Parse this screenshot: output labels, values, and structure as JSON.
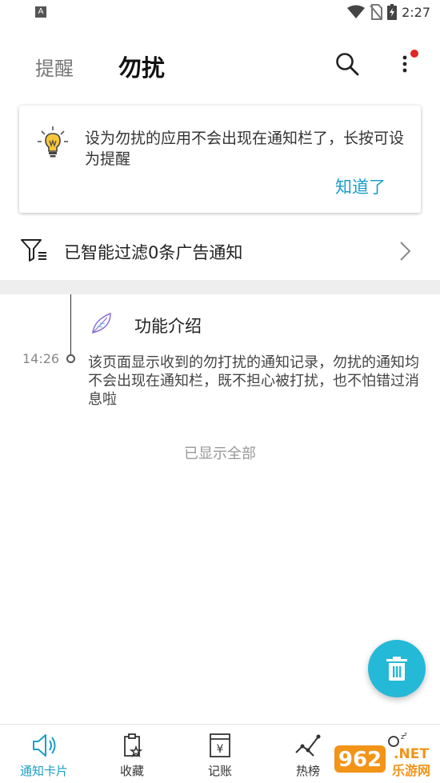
{
  "status_bar": {
    "app_icon_letter": "A",
    "time": "2:27",
    "icons": [
      "wifi-icon",
      "no-sim-icon",
      "battery-charging-icon"
    ]
  },
  "header": {
    "tab_remind": "提醒",
    "tab_dnd": "勿扰",
    "search_icon": "search-icon",
    "more_icon": "more-vertical-icon",
    "badge_color": "#e0261f"
  },
  "tip": {
    "text": "设为勿扰的应用不会出现在通知栏了，长按可设为提醒",
    "ok_label": "知道了",
    "icon": "lightbulb-icon",
    "accent": "#1a9fc7"
  },
  "filter": {
    "text": "已智能过滤0条广告通知",
    "icon": "filter-list-icon"
  },
  "timeline": {
    "entries": [
      {
        "time": "14:26",
        "title": "功能介绍",
        "body": "该页面显示收到的勿打扰的通知记录，勿扰的通知均不会出现在通知栏，既不担心被打扰，也不怕错过消息啦",
        "icon": "feather-logo-icon"
      }
    ],
    "footer": "已显示全部"
  },
  "fab": {
    "icon": "trash-icon",
    "color": "#25b9d8"
  },
  "bottom_nav": {
    "items": [
      {
        "label": "通知卡片",
        "icon": "speaker-card-icon",
        "active": true
      },
      {
        "label": "收藏",
        "icon": "clipboard-star-icon",
        "active": false
      },
      {
        "label": "记账",
        "icon": "ledger-yen-icon",
        "active": false
      },
      {
        "label": "热榜",
        "icon": "trend-chart-icon",
        "active": false
      },
      {
        "label": "",
        "icon": "sleep-person-icon",
        "active": false
      }
    ]
  },
  "watermark": {
    "big": "962",
    "net": ".NET",
    "site": "乐游网"
  }
}
